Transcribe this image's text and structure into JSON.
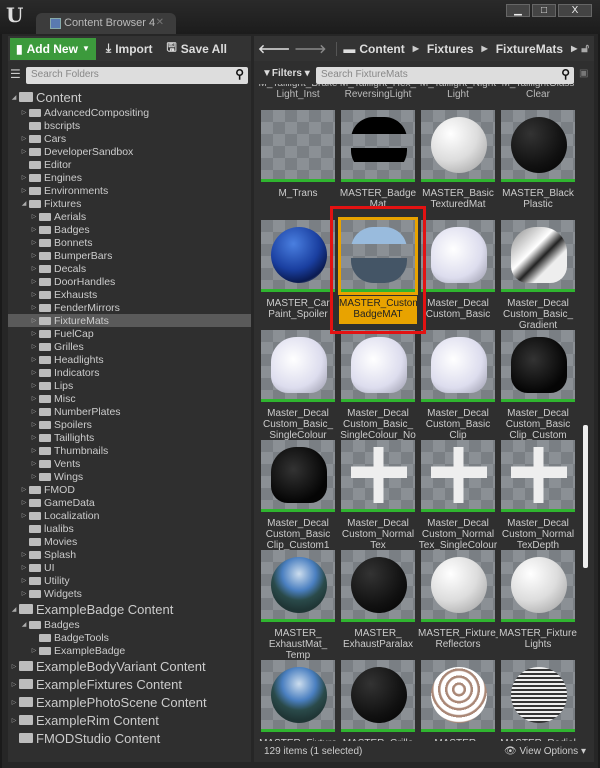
{
  "window": {
    "tab_title": "Content Browser 4",
    "minimize": "▁",
    "maximize": "□",
    "close": "X"
  },
  "toolbar": {
    "add_new": "Add New",
    "import": "Import",
    "save_all": "Save All"
  },
  "breadcrumb": [
    "Content",
    "Fixtures",
    "FixtureMats"
  ],
  "search_folders": {
    "placeholder": "Search Folders"
  },
  "filters": {
    "label": "Filters",
    "search_placeholder": "Search FixtureMats"
  },
  "tree": [
    {
      "label": "Content",
      "level": 0,
      "state": "open",
      "big": true
    },
    {
      "label": "AdvancedCompositing",
      "level": 1,
      "state": "closed"
    },
    {
      "label": "bscripts",
      "level": 1,
      "state": "none"
    },
    {
      "label": "Cars",
      "level": 1,
      "state": "closed"
    },
    {
      "label": "DeveloperSandbox",
      "level": 1,
      "state": "closed"
    },
    {
      "label": "Editor",
      "level": 1,
      "state": "none"
    },
    {
      "label": "Engines",
      "level": 1,
      "state": "closed"
    },
    {
      "label": "Environments",
      "level": 1,
      "state": "closed"
    },
    {
      "label": "Fixtures",
      "level": 1,
      "state": "open"
    },
    {
      "label": "Aerials",
      "level": 2,
      "state": "closed"
    },
    {
      "label": "Badges",
      "level": 2,
      "state": "closed"
    },
    {
      "label": "Bonnets",
      "level": 2,
      "state": "closed"
    },
    {
      "label": "BumperBars",
      "level": 2,
      "state": "closed"
    },
    {
      "label": "Decals",
      "level": 2,
      "state": "closed"
    },
    {
      "label": "DoorHandles",
      "level": 2,
      "state": "closed"
    },
    {
      "label": "Exhausts",
      "level": 2,
      "state": "closed"
    },
    {
      "label": "FenderMirrors",
      "level": 2,
      "state": "closed"
    },
    {
      "label": "FixtureMats",
      "level": 2,
      "state": "closed",
      "selected": true
    },
    {
      "label": "FuelCap",
      "level": 2,
      "state": "closed"
    },
    {
      "label": "Grilles",
      "level": 2,
      "state": "closed"
    },
    {
      "label": "Headlights",
      "level": 2,
      "state": "closed"
    },
    {
      "label": "Indicators",
      "level": 2,
      "state": "closed"
    },
    {
      "label": "Lips",
      "level": 2,
      "state": "closed"
    },
    {
      "label": "Misc",
      "level": 2,
      "state": "closed"
    },
    {
      "label": "NumberPlates",
      "level": 2,
      "state": "closed"
    },
    {
      "label": "Spoilers",
      "level": 2,
      "state": "closed"
    },
    {
      "label": "Taillights",
      "level": 2,
      "state": "closed"
    },
    {
      "label": "Thumbnails",
      "level": 2,
      "state": "closed"
    },
    {
      "label": "Vents",
      "level": 2,
      "state": "closed"
    },
    {
      "label": "Wings",
      "level": 2,
      "state": "closed"
    },
    {
      "label": "FMOD",
      "level": 1,
      "state": "closed"
    },
    {
      "label": "GameData",
      "level": 1,
      "state": "closed"
    },
    {
      "label": "Localization",
      "level": 1,
      "state": "closed"
    },
    {
      "label": "lualibs",
      "level": 1,
      "state": "none"
    },
    {
      "label": "Movies",
      "level": 1,
      "state": "none"
    },
    {
      "label": "Splash",
      "level": 1,
      "state": "closed"
    },
    {
      "label": "UI",
      "level": 1,
      "state": "closed"
    },
    {
      "label": "Utility",
      "level": 1,
      "state": "closed"
    },
    {
      "label": "Widgets",
      "level": 1,
      "state": "closed"
    },
    {
      "label": "ExampleBadge Content",
      "level": 0,
      "state": "open",
      "big": true
    },
    {
      "label": "Badges",
      "level": 1,
      "state": "open"
    },
    {
      "label": "BadgeTools",
      "level": 2,
      "state": "none"
    },
    {
      "label": "ExampleBadge",
      "level": 2,
      "state": "closed"
    },
    {
      "label": "ExampleBodyVariant Content",
      "level": 0,
      "state": "closed",
      "big": true
    },
    {
      "label": "ExampleFixtures Content",
      "level": 0,
      "state": "closed",
      "big": true
    },
    {
      "label": "ExamplePhotoScene Content",
      "level": 0,
      "state": "closed",
      "big": true
    },
    {
      "label": "ExampleRim Content",
      "level": 0,
      "state": "closed",
      "big": true
    },
    {
      "label": "FMODStudio Content",
      "level": 0,
      "state": "none",
      "big": true
    }
  ],
  "top_partial_labels": [
    "M_Taillight_Brake Light_Inst",
    "M_Taillight_Hex_ ReversingLight",
    "M_Taillight_Night Light",
    "M_TaillightGlass Clear"
  ],
  "assets": [
    {
      "label": "M_Trans",
      "thumb": "plane"
    },
    {
      "label": "MASTER_Badge Mat",
      "thumb": "badge"
    },
    {
      "label": "MASTER_Basic TexturedMat",
      "thumb": "white-sphere"
    },
    {
      "label": "MASTER_Black Plastic",
      "thumb": "black-sphere"
    },
    {
      "label": "MASTER_Car Paint_Spoiler",
      "thumb": "blue-sphere"
    },
    {
      "label": "MASTER_Custom BadgeMAT",
      "thumb": "glass",
      "selected": true
    },
    {
      "label": "Master_Decal Custom_Basic",
      "thumb": "white-cup"
    },
    {
      "label": "Master_Decal Custom_Basic_ Gradient",
      "thumb": "grey-cup"
    },
    {
      "label": "Master_Decal Custom_Basic_ SingleColour",
      "thumb": "white-cup"
    },
    {
      "label": "Master_Decal Custom_Basic_ SingleColour_No",
      "thumb": "white-cup"
    },
    {
      "label": "Master_Decal Custom_Basic Clip",
      "thumb": "white-cup"
    },
    {
      "label": "Master_Decal Custom_Basic Clip_Custom",
      "thumb": "black-cup"
    },
    {
      "label": "Master_Decal Custom_Basic Clip_Custom1",
      "thumb": "black-cup"
    },
    {
      "label": "Master_Decal Custom_Normal Tex",
      "thumb": "cross"
    },
    {
      "label": "Master_Decal Custom_Normal Tex_SingleColour",
      "thumb": "cross"
    },
    {
      "label": "Master_Decal Custom_Normal TexDepth",
      "thumb": "cross"
    },
    {
      "label": "MASTER_ ExhaustMat_ Temp",
      "thumb": "earth"
    },
    {
      "label": "MASTER_ ExhaustParalax",
      "thumb": "black-sphere"
    },
    {
      "label": "MASTER_Fixture_ Reflectors",
      "thumb": "white-sphere"
    },
    {
      "label": "MASTER_Fixture Lights",
      "thumb": "white-sphere"
    },
    {
      "label": "MASTER_Fixture",
      "thumb": "earth"
    },
    {
      "label": "MASTER_Grille",
      "thumb": "black-sphere"
    },
    {
      "label": "MASTER_",
      "thumb": "chrome"
    },
    {
      "label": "MASTER_Radial",
      "thumb": "stripes"
    }
  ],
  "status": {
    "count": "129 items (1 selected)",
    "view_options": "View Options"
  },
  "colors": {
    "accent": "#e8a300",
    "green": "#3c9a3c",
    "selection_box": "#e31212"
  }
}
